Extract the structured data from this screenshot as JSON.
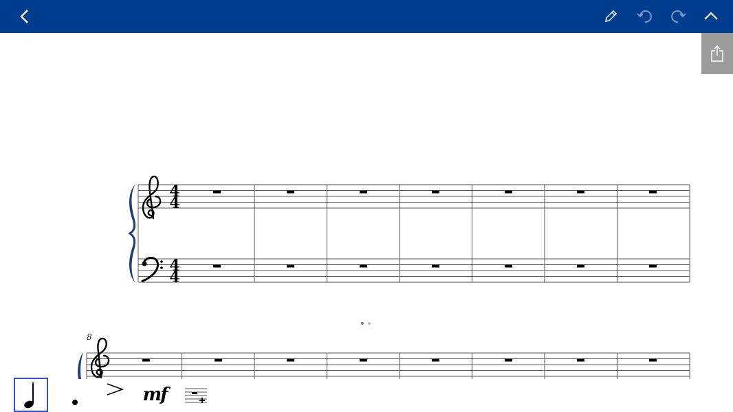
{
  "toolbar": {
    "back_icon": "chevron-left-icon",
    "edit_icon": "pencil-icon",
    "undo_icon": "undo-icon",
    "redo_icon": "redo-icon",
    "collapse_icon": "chevron-up-icon"
  },
  "side_panel": {
    "share_icon": "share-icon"
  },
  "score": {
    "system1": {
      "time_signature_top": "4",
      "time_signature_bottom": "4",
      "measures": 7
    },
    "system2": {
      "measure_number": "8",
      "measures": 8
    }
  },
  "page_indicator": {
    "pages": 2,
    "current": 1
  },
  "palette": {
    "items": [
      {
        "name": "quarter-note-icon",
        "selected": true
      },
      {
        "name": "dot-icon",
        "selected": false
      },
      {
        "name": "accent-icon",
        "selected": false
      },
      {
        "name": "mf-dynamic",
        "label": "mf",
        "selected": false
      },
      {
        "name": "add-measure-icon",
        "selected": false
      }
    ]
  },
  "colors": {
    "topbar": "#003d8f",
    "brace": "#1f3f7a",
    "selection": "#2f4fd8",
    "share_panel": "#9c9c9c"
  }
}
